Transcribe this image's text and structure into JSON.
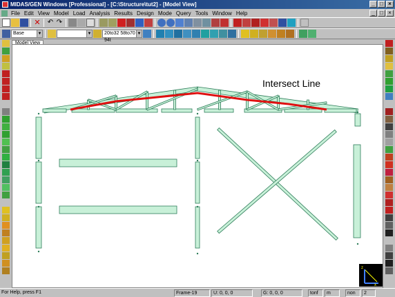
{
  "window": {
    "title": "MIDAS/GEN Windows [Professional] - [C:\\Structure\\tut2] - [Model View]",
    "controls": [
      "_",
      "□",
      "×"
    ]
  },
  "menu": [
    "File",
    "Edit",
    "View",
    "Model",
    "Load",
    "Analysis",
    "Results",
    "Design",
    "Mode",
    "Query",
    "Tools",
    "Window",
    "Help"
  ],
  "toolbar2": {
    "base_combo": "Base",
    "blank_combo": "",
    "section_combo": "20to32 58to70 94t"
  },
  "tab": "Model View",
  "annotation": "Intersect Line",
  "status": {
    "help": "For Help, press F1",
    "frame": "Frame-19",
    "u": "U: 0, 0, 0",
    "g": "G: 0, 0, 0",
    "unit1": "tonf",
    "unit2": "m",
    "mode": "non",
    "page": "2"
  },
  "colors": {
    "member_fill": "#c8f0d8",
    "member_stroke": "#2e7d5a",
    "intersect": "#e01010",
    "titlebar": "#0a246a"
  }
}
